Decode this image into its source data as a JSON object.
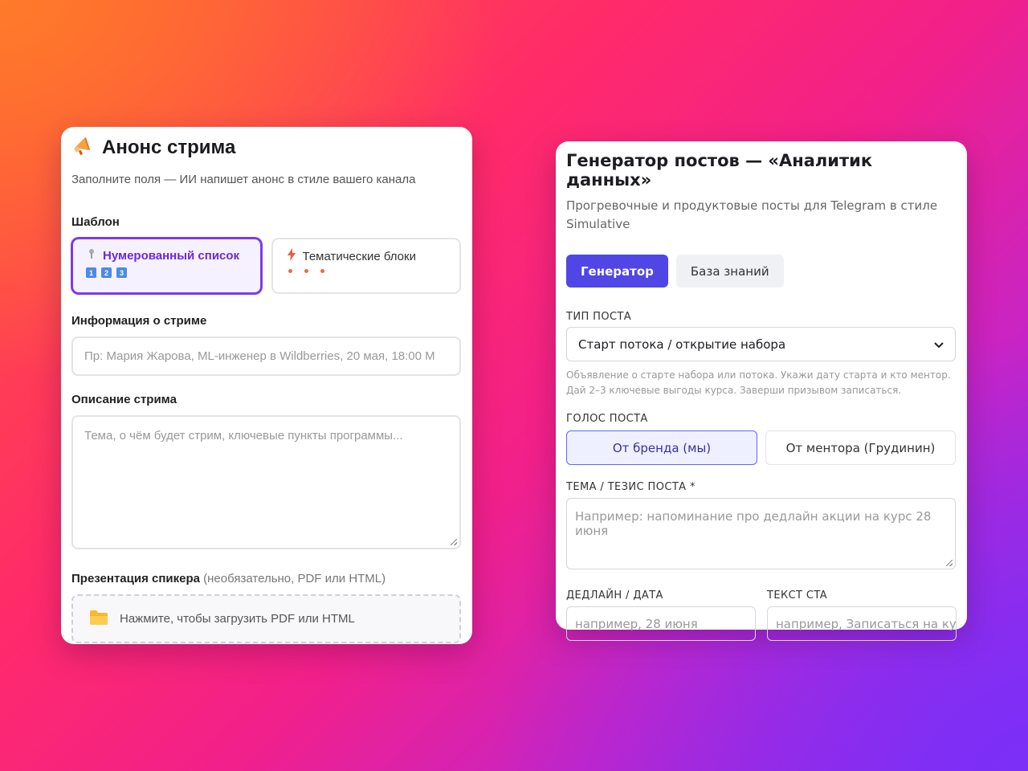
{
  "left": {
    "title": "Анонс стрима",
    "subtitle": "Заполните поля — ИИ напишет анонс в стиле вашего канала",
    "template_label": "Шаблон",
    "templates": [
      {
        "label": "Нумерованный список",
        "selected": true,
        "preview": [
          "1",
          "2",
          "3"
        ]
      },
      {
        "label": "Тематические блоки",
        "selected": false
      }
    ],
    "info_label": "Информация о стриме",
    "info_placeholder": "Пр: Мария Жарова, ML-инженер в Wildberries, 20 мая, 18:00 M",
    "desc_label": "Описание стрима",
    "desc_placeholder": "Тема, о чём будет стрим, ключевые пункты программы...",
    "presentation_label": "Презентация спикера",
    "presentation_hint": "(необязательно, PDF или HTML)",
    "upload_text": "Нажмите, чтобы загрузить PDF или HTML"
  },
  "right": {
    "title": "Генератор постов — «Аналитик данных»",
    "subtitle": "Прогревочные и продуктовые посты для Telegram в стиле Simulative",
    "tabs": [
      {
        "label": "Генератор",
        "active": true
      },
      {
        "label": "База знаний",
        "active": false
      }
    ],
    "post_type_label": "ТИП ПОСТА",
    "post_type_value": "Старт потока / открытие набора",
    "post_type_hint": "Объявление о старте набора или потока. Укажи дату старта и кто ментор. Дай 2–3 ключевые выгоды курса. Заверши призывом записаться.",
    "voice_label": "ГОЛОС ПОСТА",
    "voices": [
      {
        "label": "От бренда (мы)",
        "active": true
      },
      {
        "label": "От ментора (Грудинин)",
        "active": false
      }
    ],
    "topic_label": "ТЕМА / ТЕЗИС ПОСТА *",
    "topic_placeholder": "Например: напоминание про дедлайн акции на курс 28 июня",
    "deadline_label": "ДЕДЛАЙН / ДАТА",
    "deadline_placeholder": "например, 28 июня",
    "cta_label": "ТЕКСТ CTA",
    "cta_placeholder": "например, Записаться на кур"
  },
  "colors": {
    "accent_purple": "#7c3aed",
    "accent_indigo": "#4f46e5"
  }
}
